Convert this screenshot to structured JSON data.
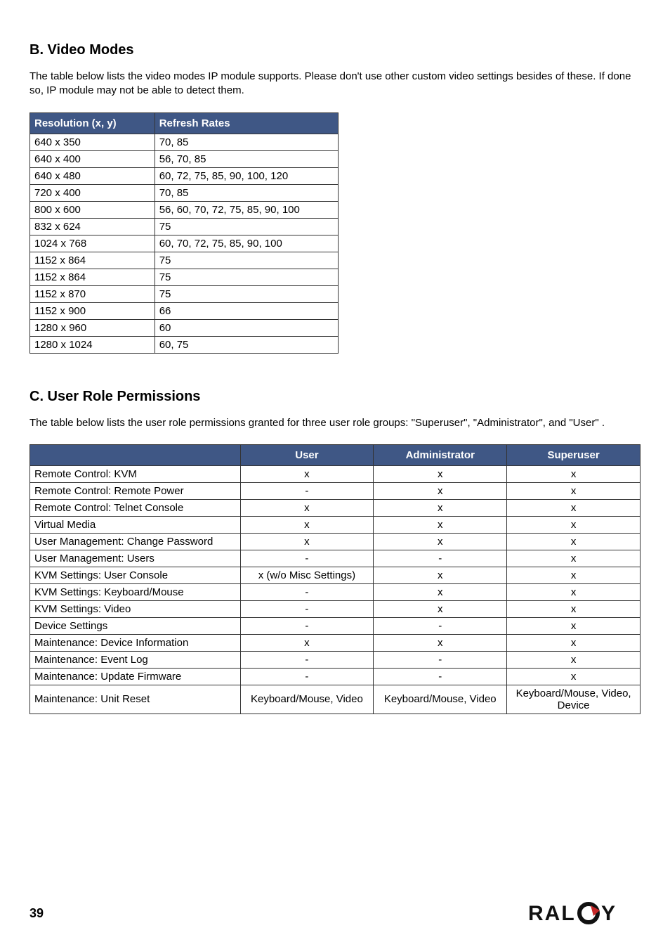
{
  "sectionB": {
    "heading": "B.  Video Modes",
    "intro": "The table below lists the video modes IP module supports. Please don't use other custom video settings besides of these. If done so, IP module may not be able to detect them.",
    "headers": [
      "Resolution (x, y)",
      "Refresh Rates"
    ],
    "rows": [
      [
        "640 x 350",
        "70, 85"
      ],
      [
        "640 x 400",
        "56, 70, 85"
      ],
      [
        "640 x 480",
        "60, 72, 75, 85, 90, 100, 120"
      ],
      [
        "720 x 400",
        "70, 85"
      ],
      [
        "800 x 600",
        "56, 60, 70, 72, 75, 85, 90, 100"
      ],
      [
        "832 x 624",
        "75"
      ],
      [
        "1024 x 768",
        "60, 70, 72, 75, 85, 90, 100"
      ],
      [
        "1152 x 864",
        "75"
      ],
      [
        "1152 x 864",
        "75"
      ],
      [
        "1152 x 870",
        "75"
      ],
      [
        "1152 x 900",
        "66"
      ],
      [
        "1280 x 960",
        "60"
      ],
      [
        "1280 x 1024",
        "60, 75"
      ]
    ]
  },
  "sectionC": {
    "heading": "C.  User Role Permissions",
    "intro": "The table below lists the user role permissions granted for three user role groups: \"Superuser\", \"Administrator\", and \"User\" .",
    "headers": [
      "",
      "User",
      "Administrator",
      "Superuser"
    ],
    "rows": [
      [
        "Remote Control: KVM",
        "x",
        "x",
        "x"
      ],
      [
        "Remote Control: Remote Power",
        "-",
        "x",
        "x"
      ],
      [
        "Remote Control: Telnet Console",
        "x",
        "x",
        "x"
      ],
      [
        "Virtual Media",
        "x",
        "x",
        "x"
      ],
      [
        "User Management: Change Password",
        "x",
        "x",
        "x"
      ],
      [
        "User Management: Users",
        "-",
        "-",
        "x"
      ],
      [
        "KVM Settings: User Console",
        "x (w/o Misc Settings)",
        "x",
        "x"
      ],
      [
        "KVM Settings: Keyboard/Mouse",
        "-",
        "x",
        "x"
      ],
      [
        "KVM Settings: Video",
        "-",
        "x",
        "x"
      ],
      [
        "Device Settings",
        "-",
        "-",
        "x"
      ],
      [
        "Maintenance: Device Information",
        "x",
        "x",
        "x"
      ],
      [
        "Maintenance: Event Log",
        "-",
        "-",
        "x"
      ],
      [
        "Maintenance: Update Firmware",
        "-",
        "-",
        "x"
      ],
      [
        "Maintenance: Unit Reset",
        "Keyboard/Mouse, Video",
        "Keyboard/Mouse, Video",
        "Keyboard/Mouse, Video, Device"
      ]
    ]
  },
  "footer": {
    "pageNumber": "39",
    "brand": "RALOY"
  }
}
